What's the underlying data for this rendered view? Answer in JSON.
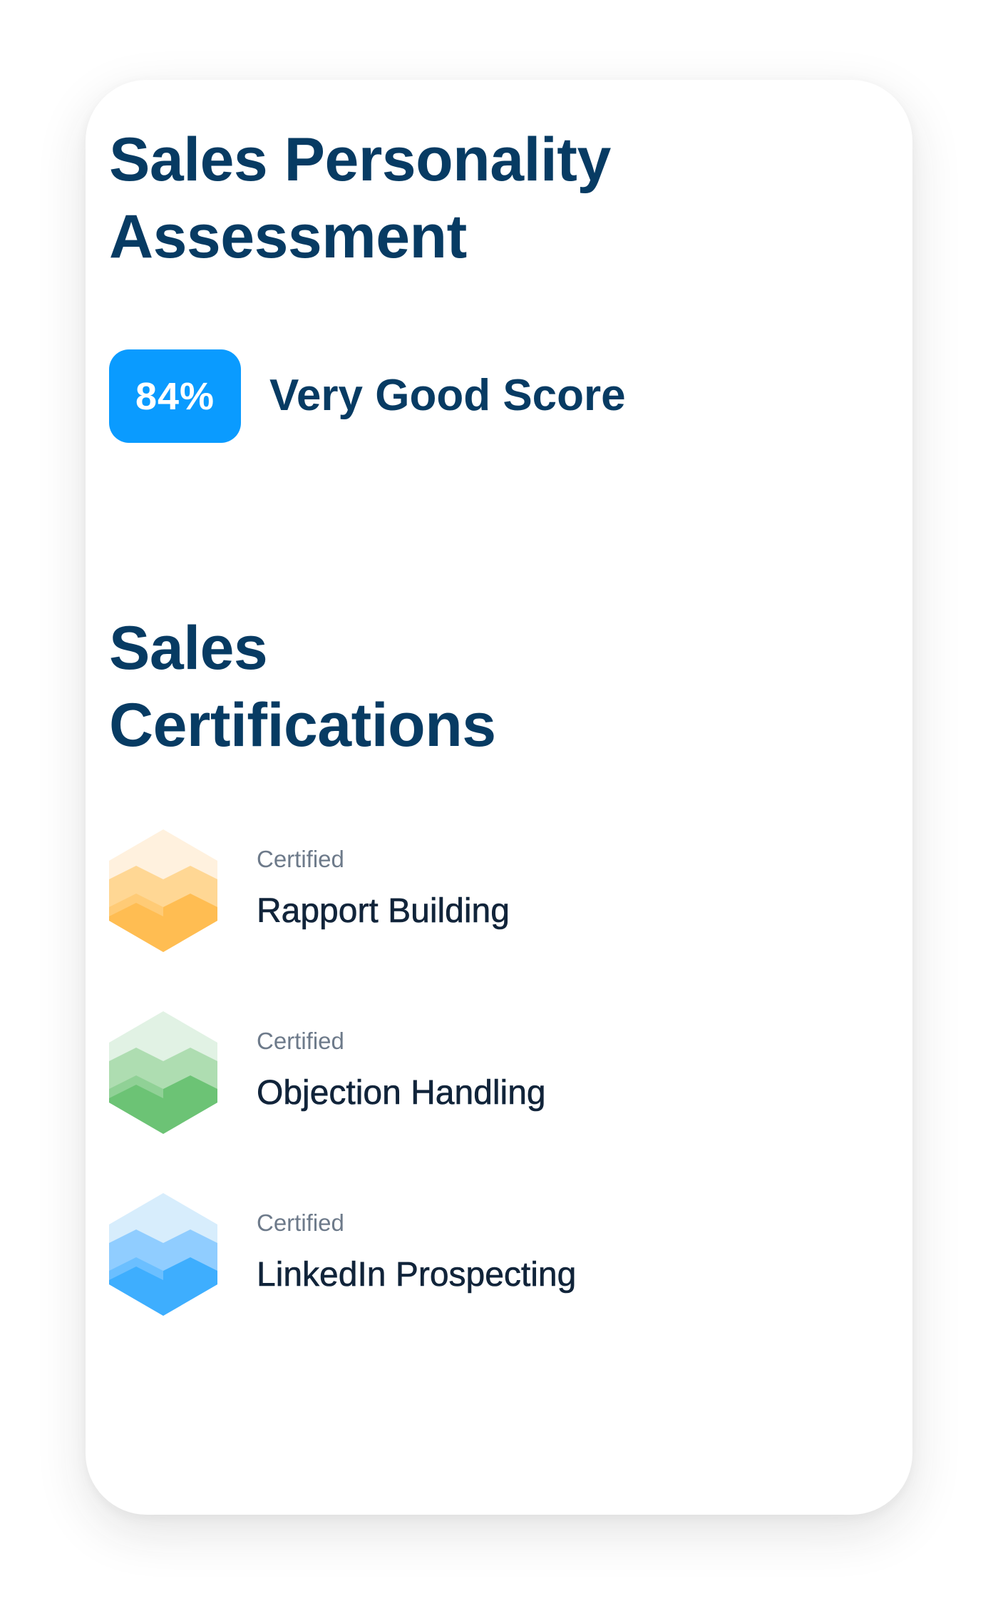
{
  "assessment": {
    "title_line1": "Sales Personality",
    "title_line2": "Assessment",
    "score": "84%",
    "score_label": "Very Good Score"
  },
  "certifications": {
    "title_line1": "Sales",
    "title_line2": "Certifications",
    "items": [
      {
        "status": "Certified",
        "name": "Rapport Building",
        "icon": "orange-hexagon-badge-icon",
        "colors": {
          "top": "#fff1de",
          "mid": "#ffd794",
          "bottom": "#ffbd52"
        }
      },
      {
        "status": "Certified",
        "name": "Objection Handling",
        "icon": "green-hexagon-badge-icon",
        "colors": {
          "top": "#e1f2e4",
          "mid": "#aeddb1",
          "bottom": "#6cc375"
        }
      },
      {
        "status": "Certified",
        "name": "LinkedIn Prospecting",
        "icon": "blue-hexagon-badge-icon",
        "colors": {
          "top": "#d7edfc",
          "mid": "#90cdff",
          "bottom": "#3eaefe"
        }
      }
    ]
  },
  "colors": {
    "heading": "#073b63",
    "badge": "#0a9bff",
    "muted_text": "#6d7a8a",
    "body_text": "#11243a"
  }
}
